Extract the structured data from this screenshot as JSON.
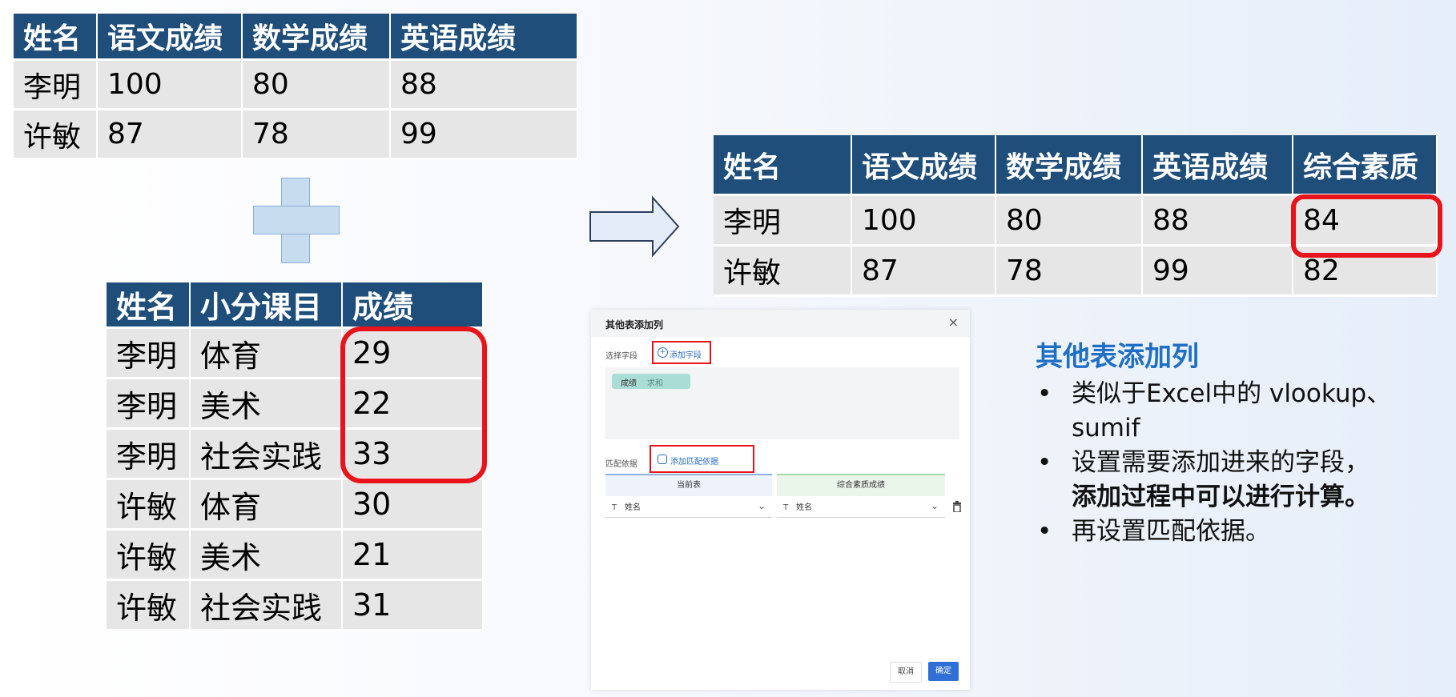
{
  "table_scores": {
    "headers": [
      "姓名",
      "语文成绩",
      "数学成绩",
      "英语成绩"
    ],
    "rows": [
      [
        "李明",
        "100",
        "80",
        "88"
      ],
      [
        "许敏",
        "87",
        "78",
        "99"
      ]
    ]
  },
  "table_minor": {
    "headers": [
      "姓名",
      "小分课目",
      "成绩"
    ],
    "rows": [
      [
        "李明",
        "体育",
        "29"
      ],
      [
        "李明",
        "美术",
        "22"
      ],
      [
        "李明",
        "社会实践",
        "33"
      ],
      [
        "许敏",
        "体育",
        "30"
      ],
      [
        "许敏",
        "美术",
        "21"
      ],
      [
        "许敏",
        "社会实践",
        "31"
      ]
    ]
  },
  "table_result": {
    "headers": [
      "姓名",
      "语文成绩",
      "数学成绩",
      "英语成绩",
      "综合素质"
    ],
    "rows": [
      [
        "李明",
        "100",
        "80",
        "88",
        "84"
      ],
      [
        "许敏",
        "87",
        "78",
        "99",
        "82"
      ]
    ]
  },
  "dialog": {
    "title": "其他表添加列",
    "close_icon": "×",
    "select_field_label": "选择字段",
    "add_field_label": "添加字段",
    "chip_field": "成绩",
    "chip_agg": "求和",
    "match_label": "匹配依据",
    "add_match_label": "添加匹配依据",
    "current_table_label": "当前表",
    "other_table_label": "综合素质成绩",
    "left_select_value": "姓名",
    "right_select_value": "姓名",
    "cancel_label": "取消",
    "confirm_label": "确定"
  },
  "notes": {
    "title": "其他表添加列",
    "bullet": "•",
    "line1": "类似于Excel中的 vlookup、sumif",
    "line2a": "设置需要添加进来的字段，",
    "line2b": "添加过程中可以进行计算。",
    "line3": "再设置匹配依据。"
  },
  "colors": {
    "header_bg": "#1f4e7a",
    "cell_bg": "#e6e6e6",
    "highlight": "#e8131b",
    "accent": "#1f6fc5"
  }
}
